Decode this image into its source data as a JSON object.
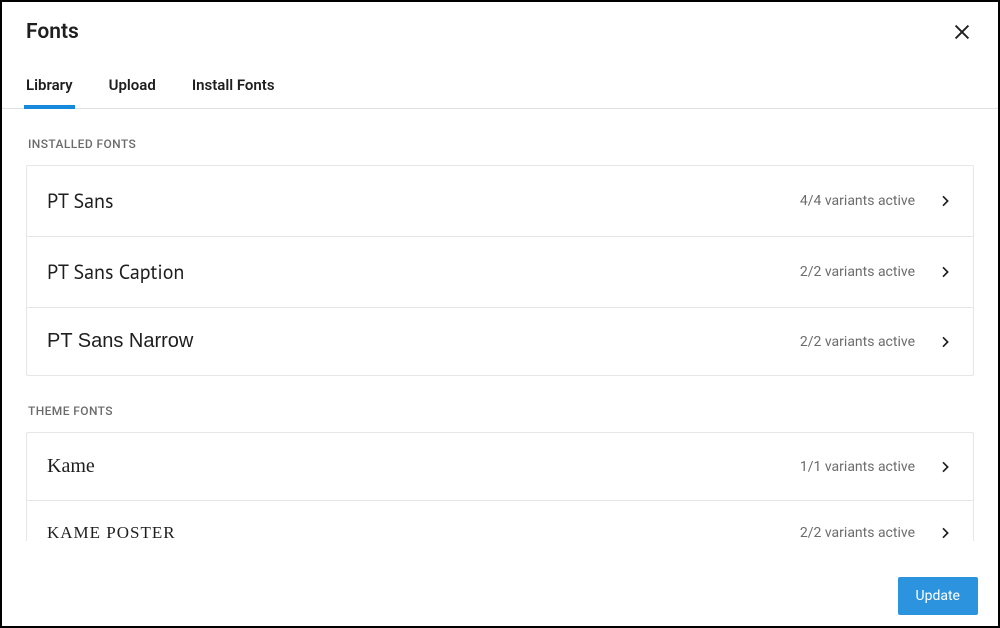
{
  "header": {
    "title": "Fonts"
  },
  "tabs": {
    "library": "Library",
    "upload": "Upload",
    "install": "Install Fonts"
  },
  "sections": {
    "installed_label": "INSTALLED FONTS",
    "theme_label": "THEME FONTS"
  },
  "installed_fonts": [
    {
      "name": "PT Sans",
      "variants": "4/4 variants active",
      "style": "pt-sans"
    },
    {
      "name": "PT Sans Caption",
      "variants": "2/2 variants active",
      "style": "pt-sans"
    },
    {
      "name": "PT Sans Narrow",
      "variants": "2/2 variants active",
      "style": "narrow"
    }
  ],
  "theme_fonts": [
    {
      "name": "Kame",
      "variants": "1/1 variants active",
      "style": "serif-light"
    },
    {
      "name": "KAME POSTER",
      "variants": "2/2 variants active",
      "style": "poster"
    }
  ],
  "footer": {
    "update_label": "Update"
  }
}
